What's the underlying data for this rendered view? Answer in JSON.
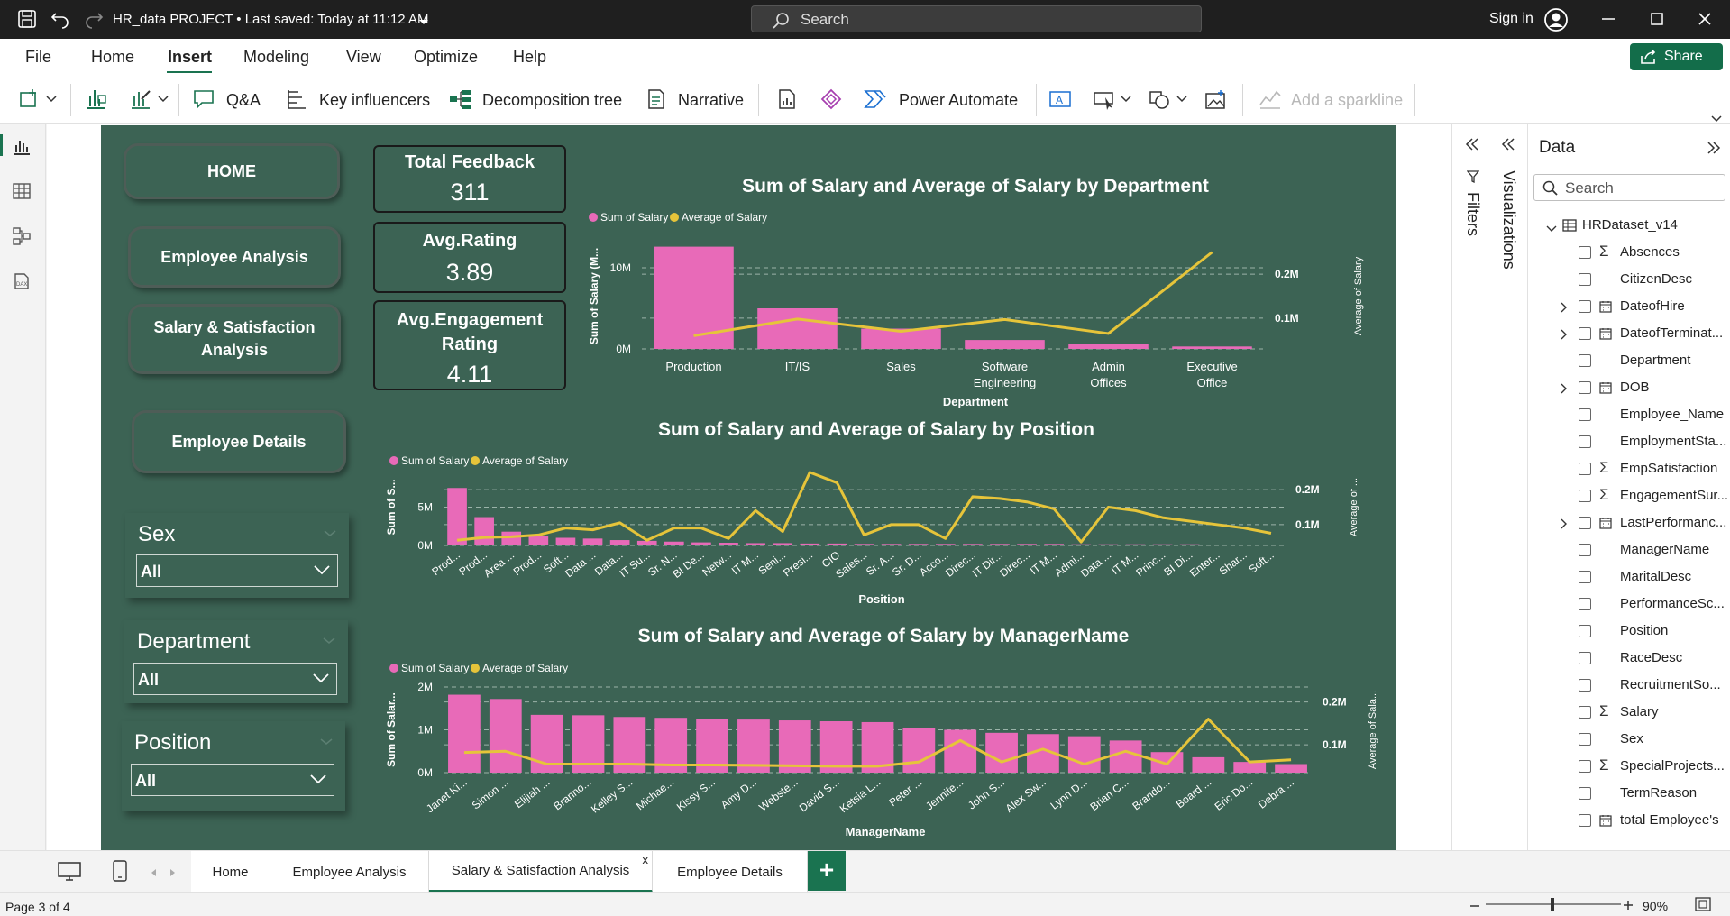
{
  "titlebar": {
    "doc_title": "HR_data PROJECT • Last saved: Today at 11:12 AM",
    "search_placeholder": "Search",
    "signin": "Sign in"
  },
  "menu": {
    "items": [
      "File",
      "Home",
      "Insert",
      "Modeling",
      "View",
      "Optimize",
      "Help"
    ],
    "active": "Insert",
    "share": "Share"
  },
  "toolbar": {
    "qa": "Q&A",
    "key_influencers": "Key influencers",
    "decomposition_tree": "Decomposition tree",
    "narrative": "Narrative",
    "power_automate": "Power Automate",
    "add_sparkline": "Add a sparkline"
  },
  "nav_buttons": {
    "home": "HOME",
    "employee_analysis": "Employee Analysis",
    "salary_satisfaction": "Salary & Satisfaction Analysis",
    "employee_details": "Employee Details"
  },
  "cards": [
    {
      "title": "Total Feedback",
      "value": "311"
    },
    {
      "title": "Avg.Rating",
      "value": "3.89"
    },
    {
      "title": "Avg.Engagement Rating",
      "value": "4.11"
    }
  ],
  "slicers": [
    {
      "title": "Sex",
      "value": "All"
    },
    {
      "title": "Department",
      "value": "All"
    },
    {
      "title": "Position",
      "value": "All"
    }
  ],
  "colors": {
    "bar": "#e86ab8",
    "line": "#e6c43a",
    "report_bg": "#3c6354",
    "accent": "#1a7350"
  },
  "chart_data": [
    {
      "type": "bar",
      "title": "Sum of Salary and Average of Salary by Department",
      "xlabel": "Department",
      "ylabel": "Sum of Salary (M...",
      "y2label": "Average of Salary",
      "legend": [
        "Sum of Salary",
        "Average of Salary"
      ],
      "yticks": [
        "0M",
        "10M"
      ],
      "y2ticks": [
        "0.1M",
        "0.2M"
      ],
      "ylim": [
        0,
        13
      ],
      "y2lim": [
        0.03,
        0.27
      ],
      "categories": [
        "Production",
        "IT/IS",
        "Sales",
        "Software Engineering",
        "Admin Offices",
        "Executive Office"
      ],
      "series": [
        {
          "name": "Sum of Salary",
          "kind": "bar",
          "values": [
            12.6,
            5.0,
            2.5,
            1.1,
            0.6,
            0.3
          ]
        },
        {
          "name": "Average of Salary",
          "kind": "line",
          "values": [
            0.06,
            0.098,
            0.07,
            0.097,
            0.065,
            0.25
          ]
        }
      ]
    },
    {
      "type": "bar",
      "title": "Sum of Salary and Average of Salary by Position",
      "xlabel": "Position",
      "ylabel": "Sum of S...",
      "y2label": "Average of ...",
      "legend": [
        "Sum of Salary",
        "Average of Salary"
      ],
      "yticks": [
        "0M",
        "5M"
      ],
      "y2ticks": [
        "0.1M",
        "0.2M"
      ],
      "ylim": [
        0,
        10
      ],
      "y2lim": [
        0.04,
        0.26
      ],
      "categories": [
        "Prod...",
        "Prod...",
        "Area ...",
        "Prod...",
        "Soft...",
        "Data ...",
        "Data...",
        "IT Su...",
        "Sr. N...",
        "BI De...",
        "Netw...",
        "IT M...",
        "Seni...",
        "Presi...",
        "CIO",
        "Sales...",
        "Sr. A...",
        "Sr. D...",
        "Acco...",
        "Direc...",
        "IT Dir...",
        "Direc...",
        "IT M...",
        "Admi...",
        "Data ...",
        "IT M...",
        "Princ...",
        "BI Di...",
        "Enter...",
        "Shar...",
        "Soft..."
      ],
      "series": [
        {
          "name": "Sum of Salary",
          "kind": "bar",
          "values": [
            7.5,
            3.7,
            1.8,
            1.2,
            1.0,
            0.9,
            0.7,
            0.6,
            0.5,
            0.4,
            0.35,
            0.3,
            0.3,
            0.25,
            0.25,
            0.2,
            0.2,
            0.2,
            0.2,
            0.2,
            0.2,
            0.2,
            0.2,
            0.15,
            0.15,
            0.15,
            0.15,
            0.15,
            0.1,
            0.1,
            0.1
          ]
        },
        {
          "name": "Average of Salary",
          "kind": "line",
          "values": [
            0.055,
            0.063,
            0.065,
            0.07,
            0.09,
            0.085,
            0.105,
            0.055,
            0.09,
            0.09,
            0.06,
            0.14,
            0.08,
            0.25,
            0.22,
            0.07,
            0.1,
            0.1,
            0.06,
            0.18,
            0.175,
            0.165,
            0.145,
            0.05,
            0.15,
            0.14,
            0.12,
            0.11,
            0.1,
            0.09,
            0.075
          ]
        }
      ]
    },
    {
      "type": "bar",
      "title": "Sum of Salary and Average of Salary by ManagerName",
      "xlabel": "ManagerName",
      "ylabel": "Sum of Salar...",
      "y2label": "Average of Sala...",
      "legend": [
        "Sum of Salary",
        "Average of Salary"
      ],
      "yticks": [
        "0M",
        "1M",
        "2M"
      ],
      "y2ticks": [
        "0.1M",
        "0.2M"
      ],
      "ylim": [
        0,
        2
      ],
      "y2lim": [
        0.035,
        0.235
      ],
      "categories": [
        "Janet Ki...",
        "Simon ...",
        "Elijiah ...",
        "Branno...",
        "Kelley S...",
        "Michae...",
        "Kissy S...",
        "Amy D...",
        "Webste...",
        "David S...",
        "Ketsia L...",
        "Peter ...",
        "Jennife...",
        "John S...",
        "Alex Sw...",
        "Lynn D...",
        "Brian C...",
        "Brando...",
        "Board ...",
        "Eric Do...",
        "Debra ..."
      ],
      "series": [
        {
          "name": "Sum of Salary",
          "kind": "bar",
          "values": [
            1.82,
            1.72,
            1.35,
            1.34,
            1.3,
            1.28,
            1.26,
            1.24,
            1.22,
            1.2,
            1.18,
            1.05,
            1.0,
            0.93,
            0.9,
            0.85,
            0.75,
            0.48,
            0.36,
            0.25,
            0.2
          ]
        },
        {
          "name": "Average of Salary",
          "kind": "line",
          "values": [
            0.082,
            0.085,
            0.055,
            0.055,
            0.055,
            0.053,
            0.053,
            0.052,
            0.051,
            0.05,
            0.05,
            0.06,
            0.11,
            0.06,
            0.09,
            0.055,
            0.085,
            0.055,
            0.16,
            0.06,
            0.065
          ]
        }
      ]
    }
  ],
  "panes": {
    "filters": "Filters",
    "visualizations": "Visualizations"
  },
  "data_pane": {
    "title": "Data",
    "search_placeholder": "Search",
    "dataset": "HRDataset_v14",
    "fields": [
      {
        "name": "Absences",
        "sigma": true,
        "expand": false,
        "calendar": false
      },
      {
        "name": "CitizenDesc",
        "sigma": false,
        "expand": false,
        "calendar": false
      },
      {
        "name": "DateofHire",
        "sigma": false,
        "expand": true,
        "calendar": true
      },
      {
        "name": "DateofTerminat...",
        "sigma": false,
        "expand": true,
        "calendar": true
      },
      {
        "name": "Department",
        "sigma": false,
        "expand": false,
        "calendar": false
      },
      {
        "name": "DOB",
        "sigma": false,
        "expand": true,
        "calendar": true
      },
      {
        "name": "Employee_Name",
        "sigma": false,
        "expand": false,
        "calendar": false
      },
      {
        "name": "EmploymentSta...",
        "sigma": false,
        "expand": false,
        "calendar": false
      },
      {
        "name": "EmpSatisfaction",
        "sigma": true,
        "expand": false,
        "calendar": false
      },
      {
        "name": "EngagementSur...",
        "sigma": true,
        "expand": false,
        "calendar": false
      },
      {
        "name": "LastPerformanc...",
        "sigma": false,
        "expand": true,
        "calendar": true
      },
      {
        "name": "ManagerName",
        "sigma": false,
        "expand": false,
        "calendar": false
      },
      {
        "name": "MaritalDesc",
        "sigma": false,
        "expand": false,
        "calendar": false
      },
      {
        "name": "PerformanceSc...",
        "sigma": false,
        "expand": false,
        "calendar": false
      },
      {
        "name": "Position",
        "sigma": false,
        "expand": false,
        "calendar": false
      },
      {
        "name": "RaceDesc",
        "sigma": false,
        "expand": false,
        "calendar": false
      },
      {
        "name": "RecruitmentSo...",
        "sigma": false,
        "expand": false,
        "calendar": false
      },
      {
        "name": "Salary",
        "sigma": true,
        "expand": false,
        "calendar": false
      },
      {
        "name": "Sex",
        "sigma": false,
        "expand": false,
        "calendar": false
      },
      {
        "name": "SpecialProjects...",
        "sigma": true,
        "expand": false,
        "calendar": false
      },
      {
        "name": "TermReason",
        "sigma": false,
        "expand": false,
        "calendar": false
      },
      {
        "name": "total Employee's",
        "sigma": false,
        "expand": false,
        "calendar": true
      }
    ]
  },
  "tabs": {
    "items": [
      "Home",
      "Employee Analysis",
      "Salary & Satisfaction Analysis",
      "Employee Details"
    ],
    "active": "Salary & Satisfaction Analysis",
    "close": "x",
    "add": "+"
  },
  "status": {
    "page": "Page 3 of 4",
    "zoom": "90%"
  }
}
